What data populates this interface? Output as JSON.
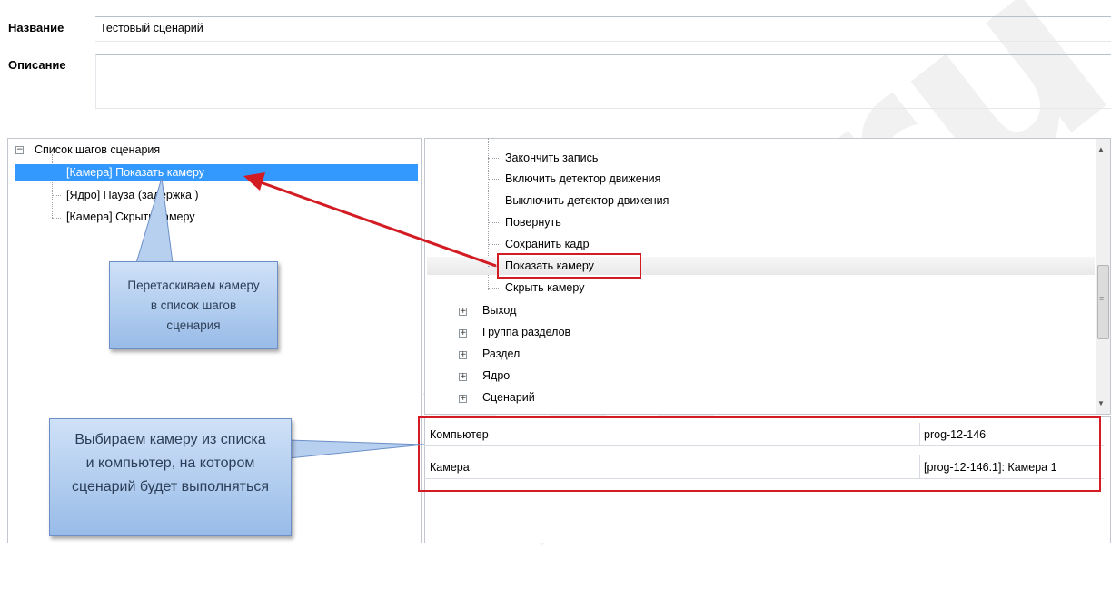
{
  "form": {
    "name_label": "Название",
    "name_value": "Тестовый сценарий",
    "description_label": "Описание",
    "description_value": ""
  },
  "steps_tree": {
    "root_label": "Список шагов сценария",
    "items": [
      {
        "label": "[Камера] Показать камеру",
        "selected": true
      },
      {
        "label": "[Ядро] Пауза (задержка )",
        "selected": false
      },
      {
        "label": "[Камера] Скрыть камеру",
        "selected": false
      }
    ]
  },
  "actions_tree": {
    "camera_actions": [
      "Закончить запись",
      "Включить детектор движения",
      "Выключить детектор движения",
      "Повернуть",
      "Сохранить кадр",
      "Показать камеру",
      "Скрыть камеру"
    ],
    "groups": [
      "Выход",
      "Группа разделов",
      "Раздел",
      "Ядро",
      "Сценарий"
    ]
  },
  "properties": [
    {
      "name": "Компьютер",
      "value": "prog-12-146"
    },
    {
      "name": "Камера",
      "value": "[prog-12-146.1]: Камера 1"
    }
  ],
  "callouts": {
    "drag_text": "Перетаскиваем камеру в список шагов сценария",
    "select_text": "Выбираем камеру из списка и компьютер, на котором сценарий будет выполняться"
  },
  "colors": {
    "selection": "#3399ff",
    "highlight_border": "#d31b23",
    "callout_fill": "#a9c7ee"
  },
  "watermark": "lid.ru"
}
